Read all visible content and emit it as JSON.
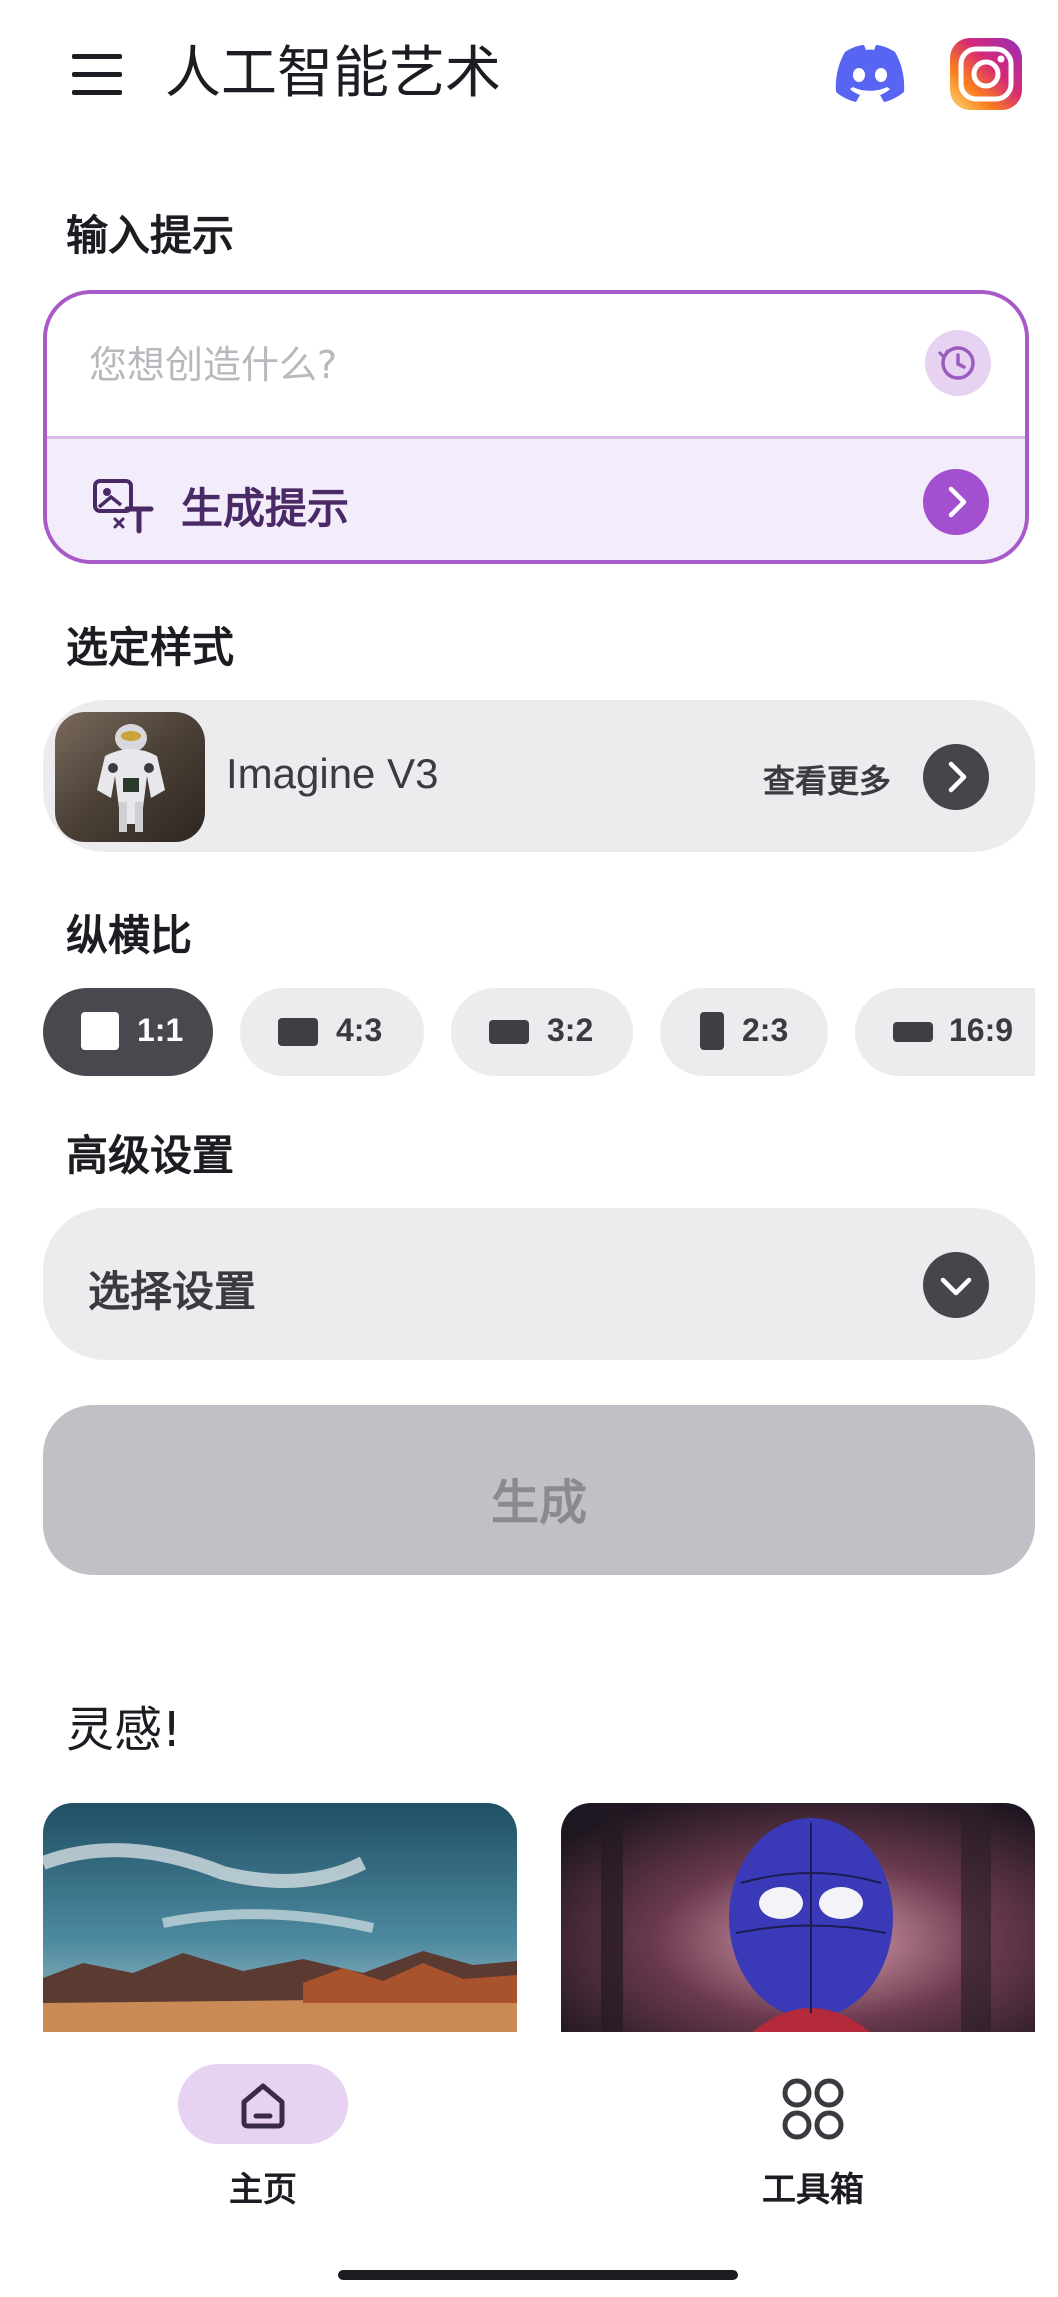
{
  "header": {
    "title": "人工智能艺术",
    "icons": [
      "menu-icon",
      "discord-icon",
      "instagram-icon"
    ]
  },
  "prompt": {
    "section_label": "输入提示",
    "placeholder": "您想创造什么?",
    "generate_prompt_label": "生成提示",
    "accent_color": "#a24fd0"
  },
  "style": {
    "section_label": "选定样式",
    "selected_name": "Imagine V3",
    "see_more": "查看更多"
  },
  "aspect": {
    "section_label": "纵横比",
    "options": [
      {
        "label": "1:1",
        "selected": true
      },
      {
        "label": "4:3",
        "selected": false
      },
      {
        "label": "3:2",
        "selected": false
      },
      {
        "label": "2:3",
        "selected": false
      },
      {
        "label": "16:9",
        "selected": false
      }
    ]
  },
  "advanced": {
    "section_label": "高级设置",
    "select_label": "选择设置"
  },
  "generate": {
    "label": "生成"
  },
  "inspiration": {
    "title": "灵感!"
  },
  "nav": {
    "items": [
      {
        "label": "主页",
        "icon": "home-icon",
        "active": true
      },
      {
        "label": "工具箱",
        "icon": "toolbox-icon",
        "active": false
      }
    ]
  }
}
